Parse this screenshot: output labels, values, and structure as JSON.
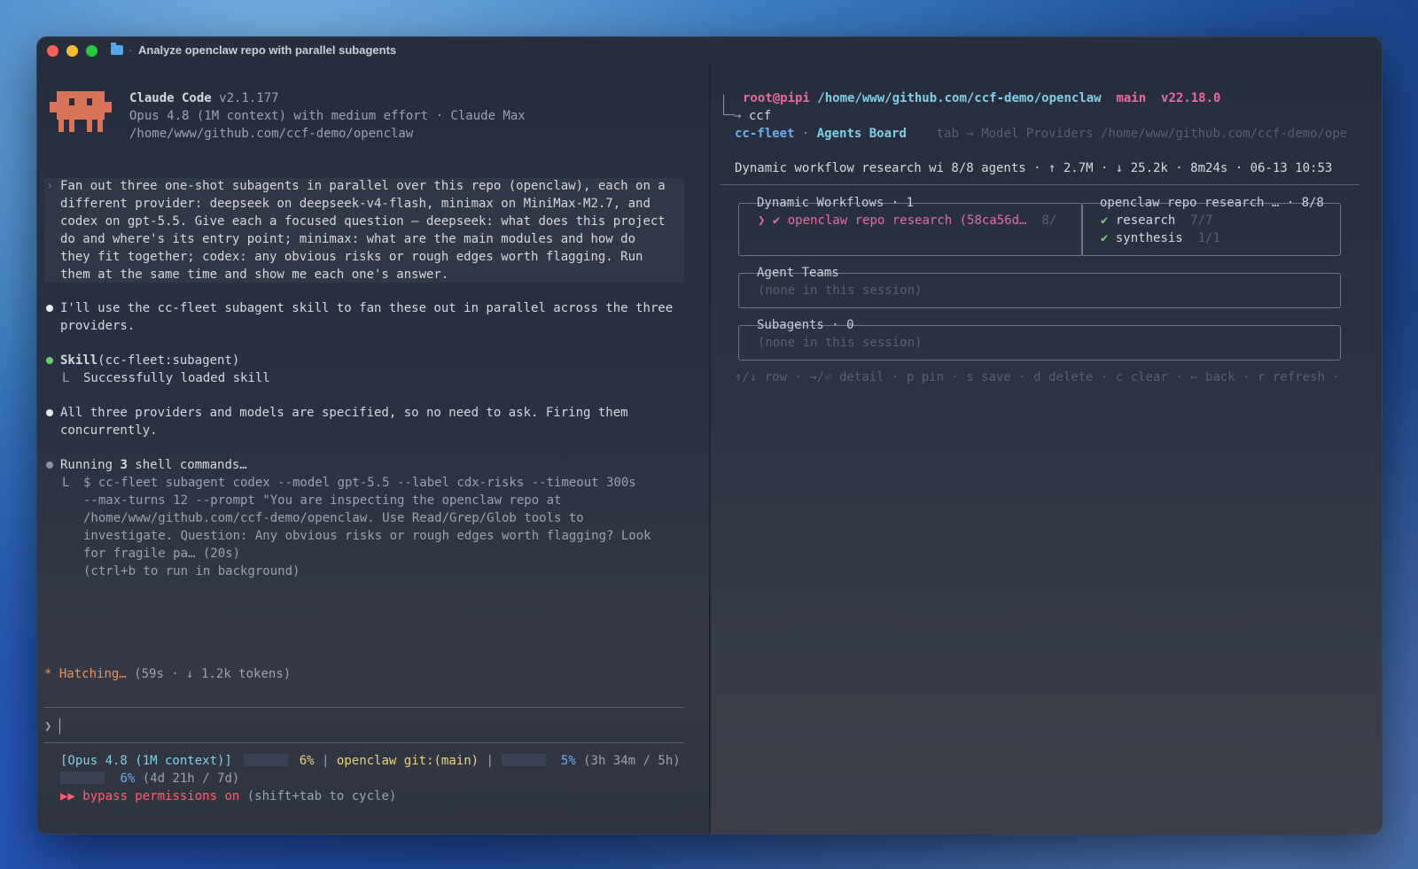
{
  "window": {
    "title": "Analyze openclaw repo with parallel subagents",
    "title_sep": "·"
  },
  "left": {
    "app_name": "Claude Code",
    "version": "v2.1.177",
    "model_line": "Opus 4.8 (1M context) with medium effort · Claude Max",
    "cwd": "/home/www/github.com/ccf-demo/openclaw",
    "prompt_lines": [
      "Fan out three one-shot subagents in parallel over this repo (openclaw), each on a",
      "different provider: deepseek on deepseek-v4-flash, minimax on MiniMax-M2.7, and",
      "codex on gpt-5.5. Give each a focused question — deepseek: what does this project",
      "do and where's its entry point; minimax: what are the main modules and how do",
      "they fit together; codex: any obvious risks or rough edges worth flagging. Run",
      "them at the same time and show me each one's answer."
    ],
    "msg1_lines": [
      "I'll use the cc-fleet subagent skill to fan these out in parallel across the three",
      "providers."
    ],
    "skill_name": "Skill",
    "skill_arg": "(cc-fleet:subagent)",
    "skill_result": "Successfully loaded skill",
    "msg2_lines": [
      "All three providers and models are specified, so no need to ask. Firing them",
      "concurrently."
    ],
    "run_prefix": "Running ",
    "run_count": "3",
    "run_suffix": " shell commands…",
    "cmd_lines": [
      "$ cc-fleet subagent codex --model gpt-5.5 --label cdx-risks --timeout 300s",
      "--max-turns 12 --prompt \"You are inspecting the openclaw repo at",
      "/home/www/github.com/ccf-demo/openclaw. Use Read/Grep/Glob tools to",
      "investigate. Question: Any obvious risks or rough edges worth flagging? Look",
      "for fragile pa… (20s)",
      "(ctrl+b to run in background)"
    ],
    "tree_glyph": "L",
    "hatching_star": "*",
    "hatching_word": "Hatching…",
    "hatching_stats": "(59s · ↓ 1.2k tokens)",
    "input_caret": "❯",
    "status": {
      "model": "[Opus 4.8 (1M context)]",
      "ctx_pct": "6%",
      "sep1": "|",
      "repo": "openclaw",
      "git": "git:(main)",
      "sep2": "|",
      "session_pct": "5%",
      "session_time": "(3h 34m / 5h)",
      "week_pct": "6%",
      "week_time": "(4d 21h / 7d)",
      "bypass_arrows": "▶▶",
      "bypass_text": "bypass permissions on",
      "bypass_hint": "(shift+tab to cycle)"
    }
  },
  "right": {
    "user_host": "root@pipi",
    "path": "/home/www/github.com/ccf-demo/openclaw",
    "branch": "main",
    "node": "v22.18.0",
    "cmd_arrow": "→",
    "cmd": "ccf",
    "brand": "cc-fleet",
    "brand_sep": "·",
    "board": "Agents Board",
    "tab_hint": "tab → Model Providers /home/www/github.com/ccf-demo/ope",
    "stats_line": "Dynamic workflow research wi 8/8 agents · ↑ 2.7M · ↓ 25.2k · 8m24s · 06-13 10:53",
    "workflows_label": "Dynamic Workflows · 1",
    "workflow_item_mark": "❯ ✔",
    "workflow_item": "openclaw repo research (58ca56d…",
    "workflow_item_count": "8/",
    "research_label": "openclaw repo research … · 8/8",
    "research_steps": [
      {
        "check": "✔",
        "name": "research",
        "count": "7/7"
      },
      {
        "check": "✔",
        "name": "synthesis",
        "count": "1/1"
      }
    ],
    "teams_label": "Agent Teams",
    "teams_empty": "(none in this session)",
    "subagents_label": "Subagents · 0",
    "subagents_empty": "(none in this session)",
    "keys_hint": "↑/↓ row · →/⏎ detail · p pin · s save · d delete · c clear · ← back · r refresh ·"
  }
}
